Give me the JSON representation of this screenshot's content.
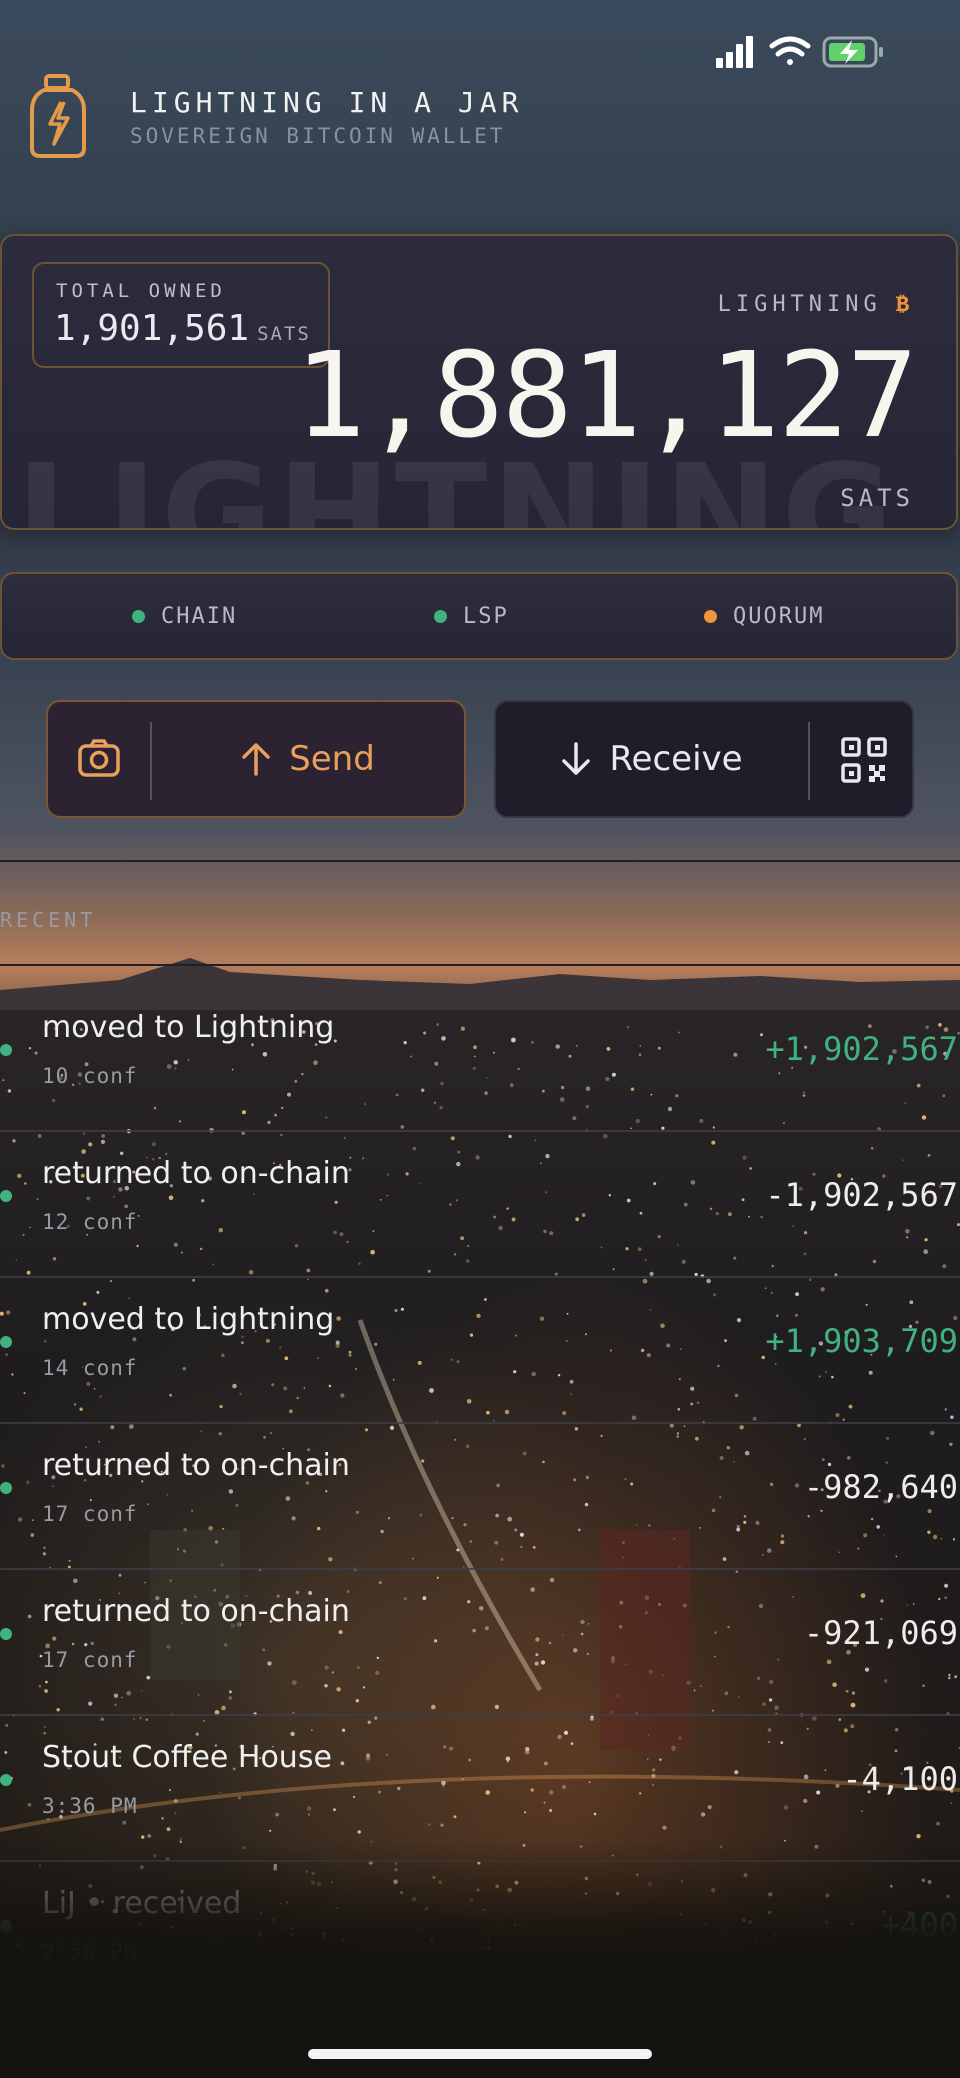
{
  "app": {
    "title": "LIGHTNING IN A JAR",
    "subtitle": "SOVEREIGN BITCOIN WALLET"
  },
  "balance_card": {
    "owned_label": "TOTAL OWNED",
    "owned_value": "1,901,561",
    "owned_unit": "SATS",
    "label": "LIGHTNING",
    "currency_symbol": "₿",
    "value": "1,881,127",
    "unit": "SATS",
    "watermark": "LIGHTNING"
  },
  "status_pills": [
    {
      "label": "CHAIN",
      "color": "#3fb27f"
    },
    {
      "label": "LSP",
      "color": "#3fb27f"
    },
    {
      "label": "QUORUM",
      "color": "#f0953a"
    }
  ],
  "actions": {
    "send_label": "Send",
    "receive_label": "Receive"
  },
  "recent": {
    "heading": "RECENT",
    "items": [
      {
        "title": "moved to Lightning",
        "sub": "10 conf",
        "amount": "+1,902,567",
        "positive": true
      },
      {
        "title": "returned to on-chain",
        "sub": "12 conf",
        "amount": "-1,902,567",
        "positive": false
      },
      {
        "title": "moved to Lightning",
        "sub": "14 conf",
        "amount": "+1,903,709",
        "positive": true
      },
      {
        "title": "returned to on-chain",
        "sub": "17 conf",
        "amount": "-982,640",
        "positive": false
      },
      {
        "title": "returned to on-chain",
        "sub": "17 conf",
        "amount": "-921,069",
        "positive": false
      },
      {
        "title": "Stout Coffee House",
        "sub": "3:36 PM",
        "amount": "-4,100",
        "positive": false
      },
      {
        "title": "LiJ • received",
        "sub": "2:56 PM",
        "amount": "+400",
        "positive": true
      }
    ]
  },
  "colors": {
    "accent": "#f0953a",
    "positive": "#3fb27f",
    "border": "#6d5336"
  }
}
